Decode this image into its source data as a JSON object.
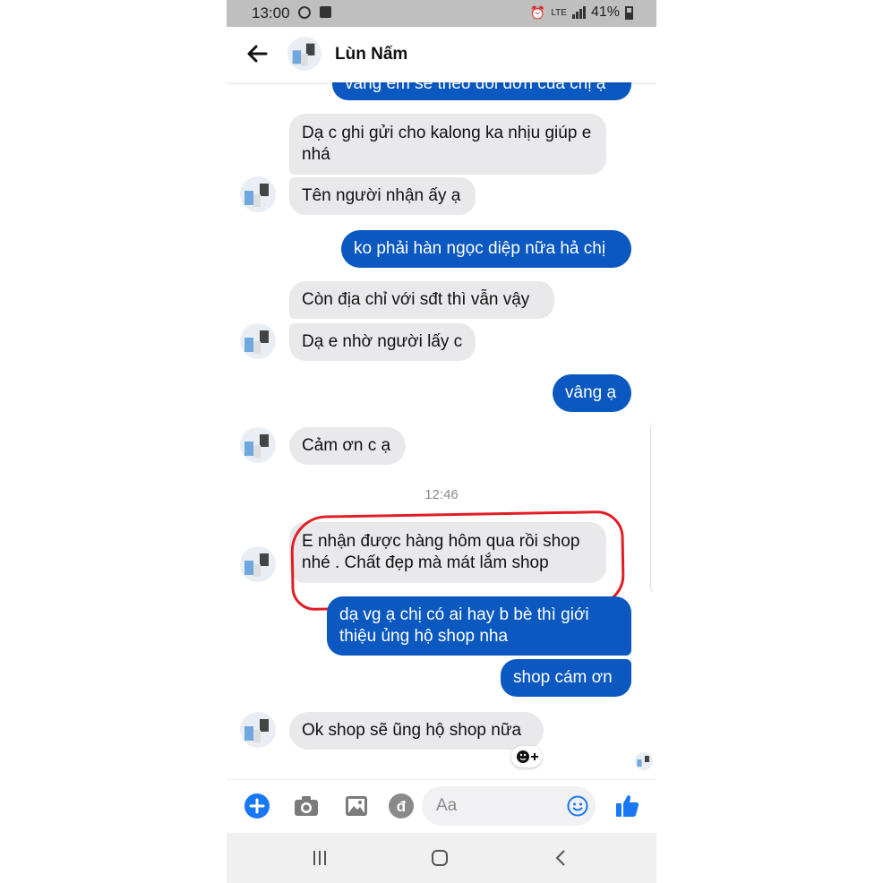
{
  "status_bar": {
    "time": "13:00",
    "battery_percent": "41%"
  },
  "header": {
    "contact_name": "Lùn Nấm"
  },
  "messages": [
    {
      "side": "out",
      "text": "vâng em sẽ theo dõi đơn của chị ạ"
    },
    {
      "side": "in",
      "text": "Dạ c ghi gửi cho kalong ka nhịu giúp e nhá"
    },
    {
      "side": "in",
      "text": "Tên người nhận ấy ạ"
    },
    {
      "side": "out",
      "text": "ko phải hàn ngọc diệp nữa hả chị"
    },
    {
      "side": "in",
      "text": "Còn địa chỉ với sđt thì vẫn vậy"
    },
    {
      "side": "in",
      "text": "Dạ e nhờ người lấy c"
    },
    {
      "side": "out",
      "text": "vâng ạ"
    },
    {
      "side": "in",
      "text": "Cảm ơn c ạ"
    },
    {
      "side": "in",
      "text": "E nhận được hàng hôm qua rồi shop nhé . Chất đẹp mà mát lắm shop"
    },
    {
      "side": "out",
      "text": "dạ vg ạ chị có ai hay b bè thì giới thiệu ủng hộ shop nha"
    },
    {
      "side": "out",
      "text": "shop cám ơn"
    },
    {
      "side": "in",
      "text": "Ok shop sẽ ũng hộ shop nữa"
    }
  ],
  "timestamp": "12:46",
  "composer": {
    "placeholder": "Aa"
  },
  "colors": {
    "outgoing_bubble": "#0b58c1",
    "incoming_bubble": "#e9e9ec",
    "messenger_blue": "#1877f2",
    "highlight_circle": "#e01e24"
  }
}
